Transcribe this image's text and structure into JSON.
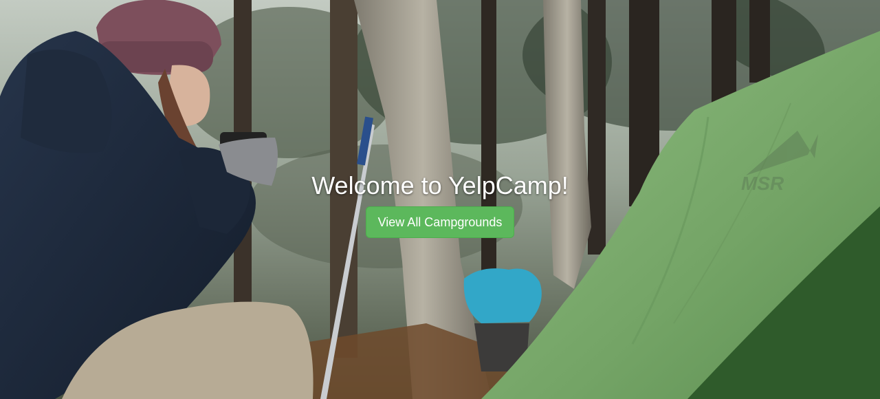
{
  "hero": {
    "title": "Welcome to YelpCamp!",
    "cta_label": "View All Campgrounds",
    "tent_logo_text": "MSR"
  },
  "colors": {
    "button_bg": "#5cb85c",
    "button_border": "#4cae4c",
    "title_text": "#ffffff",
    "tent_green": "#7aa96c"
  }
}
